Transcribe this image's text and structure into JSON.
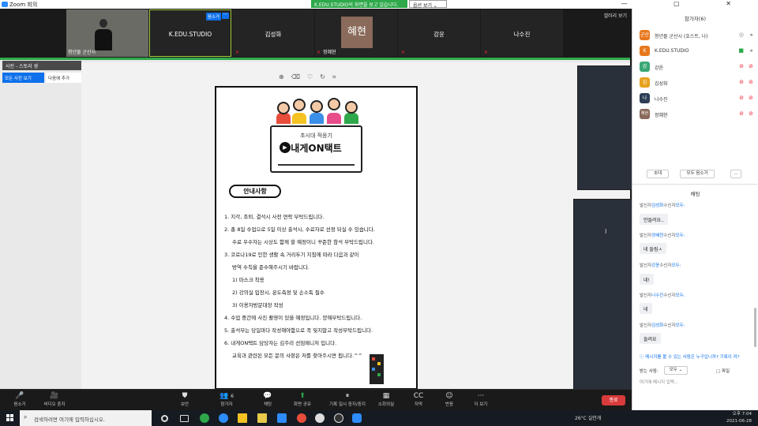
{
  "titlebar": {
    "title": "Zoom 회의",
    "controls": "— ▢ ✕"
  },
  "share": {
    "banner": "K.EDU.STUDIO의 화면을 보고 있습니다.",
    "view_options": "옵션 보기 ⌄"
  },
  "strip": {
    "gallery_view": "갤러리 보기",
    "tiles": [
      {
        "name": "청년몰 군산시",
        "type": "camera"
      },
      {
        "name": "K.EDU.STUDIO",
        "badge": "음소거",
        "dots": "···"
      },
      {
        "name": "김성화"
      },
      {
        "name": "혜현",
        "bottom_name": "정혜현"
      },
      {
        "name": "강윤"
      },
      {
        "name": "나수진"
      }
    ]
  },
  "shared": {
    "app_title": "사진 - 스토리 생",
    "photo_button": "모든 사진 보기",
    "addfav_button": "다음에 추가"
  },
  "doc": {
    "player_sub": "초시대 적응기",
    "player_main": "내게ON택트",
    "pill": "안내사항",
    "lines": [
      "1. 지각, 조퇴, 결석시 사전 연락 부탁드립니다.",
      "2. 총 8일 수업으로 5일 이상 출석시, 수료자로 선정 되실 수 있습니다.",
      "수료 우수자는 시상도 함께 할 예정이니 꾸준한 참석 부탁드립니다.",
      "3. 코로나19로 인한 생활 속 거리두기 지침에 따라 다음과 같이",
      "방역 수칙을 준수해주시기 바랍니다.",
      "1) 마스크 착용",
      "2) 강의실 입장시, 온도측정 및 손소독 필수",
      "3) 이용자방문대장 작성",
      "4. 수업 중간에 사진 촬영이 있을 예정입니다. 양해부탁드립니다.",
      "5. 출석부는 당일마다 작성해야함으로 꼭 잊지말고 작성부탁드립니다.",
      "6. 내게ON택트 담당자는 김주리 선임매니저 입니다.",
      "교육과 관련된 모든 문의 사항은 저를 찾아주시면 됩니다.^^"
    ]
  },
  "panel": {
    "participants_title": "참가자(6)",
    "participants": [
      {
        "name": "청년몰 군산시 (호스트, 나)",
        "avatar": "군산",
        "color": "#e8781e"
      },
      {
        "name": "K.EDU.STUDIO",
        "avatar": "K",
        "color": "#e8781e"
      },
      {
        "name": "강윤",
        "avatar": "강",
        "color": "#3aa876"
      },
      {
        "name": "김성화",
        "avatar": "김",
        "color": "#e8a21e"
      },
      {
        "name": "나수진",
        "avatar": "나",
        "color": "#2d3f56"
      },
      {
        "name": "정혜현",
        "avatar": "혜현",
        "color": "#8a6a5a"
      }
    ],
    "invite": "초대",
    "mute_all": "모두 음소거",
    "more": "...",
    "chat_title": "채팅",
    "messages": [
      {
        "from": "김성화",
        "text": "안들려요.."
      },
      {
        "from": "정혜현",
        "text": "네 들림ㅅ"
      },
      {
        "from": "강윤",
        "text": "네!"
      },
      {
        "from": "나수진",
        "text": "네"
      },
      {
        "from": "김성화",
        "text": "들려요"
      }
    ],
    "msg_prefix": "발신자",
    "msg_mid": "수신자",
    "msg_to": "모두:",
    "notice": "메시지를 볼 수 있는 사람은 누구입니까? 기록이 켜?",
    "to_label": "받는 사람:",
    "to_value": "모두 ⌄",
    "file_label": "파일",
    "input_placeholder": "여기에 메시지 입력..."
  },
  "toolbar": {
    "items": [
      {
        "label": "음소거",
        "icon": "mic-icon",
        "glyph": "🎤"
      },
      {
        "label": "비디오 중지",
        "icon": "video-icon",
        "glyph": "🎥"
      },
      {
        "label": "보안",
        "icon": "shield-icon",
        "glyph": "⛊"
      },
      {
        "label": "참가자",
        "icon": "participants-icon",
        "glyph": "👥"
      },
      {
        "label": "채팅",
        "icon": "chat-icon",
        "glyph": "💬"
      },
      {
        "label": "화면 공유",
        "icon": "share-icon",
        "glyph": "⬆"
      },
      {
        "label": "기록 일시 중지/중지",
        "icon": "record-icon",
        "glyph": "⏸"
      },
      {
        "label": "소회의실",
        "icon": "breakout-icon",
        "glyph": "▦"
      },
      {
        "label": "자막",
        "icon": "cc-icon",
        "glyph": "CC"
      },
      {
        "label": "반응",
        "icon": "reaction-icon",
        "glyph": "☺"
      },
      {
        "label": "더 보기",
        "icon": "more-icon",
        "glyph": "···"
      }
    ],
    "participants_count": "6",
    "end": "종료"
  },
  "taskbar": {
    "search_placeholder": "검색하려면 여기에 입력하십시오.",
    "weather": "26°C 실안개",
    "time": "오후 7:04",
    "date": "2021-06-28"
  }
}
